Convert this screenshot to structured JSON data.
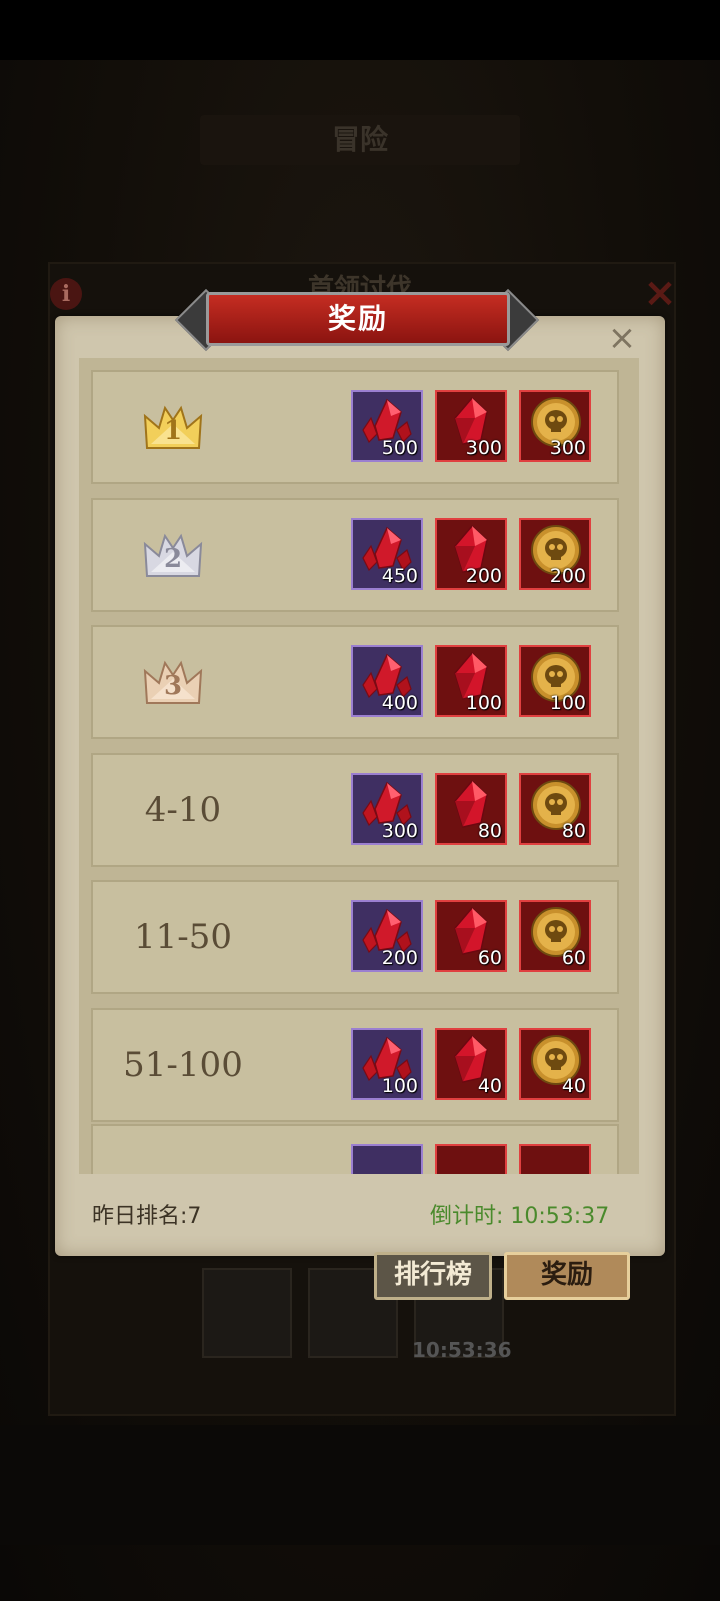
{
  "background": {
    "top_title": "冒险",
    "sub_title": "首领讨伐",
    "info_icon": "i",
    "close_icon": "×",
    "timer": "10:53:36"
  },
  "dialog": {
    "title": "奖励",
    "close": "×",
    "rows": [
      {
        "rank": "1",
        "type": "crown",
        "crown_color": "gold",
        "rewards": [
          "500",
          "300",
          "300"
        ]
      },
      {
        "rank": "2",
        "type": "crown",
        "crown_color": "silver",
        "rewards": [
          "450",
          "200",
          "200"
        ]
      },
      {
        "rank": "3",
        "type": "crown",
        "crown_color": "bronze",
        "rewards": [
          "400",
          "100",
          "100"
        ]
      },
      {
        "rank": "4-10",
        "type": "text",
        "rewards": [
          "300",
          "80",
          "80"
        ]
      },
      {
        "rank": "11-50",
        "type": "text",
        "rewards": [
          "200",
          "60",
          "60"
        ]
      },
      {
        "rank": "51-100",
        "type": "text",
        "rewards": [
          "100",
          "40",
          "40"
        ]
      }
    ],
    "reward_icons": [
      "crystal-cluster-icon",
      "red-gem-icon",
      "skull-coin-icon"
    ],
    "footer": {
      "yesterday_rank": "昨日排名:7",
      "countdown": "倒计时: 10:53:37"
    }
  },
  "buttons": {
    "leaderboard": "排行榜",
    "reward": "奖励"
  },
  "colors": {
    "panel": "#cfc6ad",
    "banner_red": "#c52d22",
    "countdown_green": "#4a8a2c",
    "gold": "#e8c048",
    "silver": "#c8c8d4",
    "bronze": "#e0b898"
  }
}
